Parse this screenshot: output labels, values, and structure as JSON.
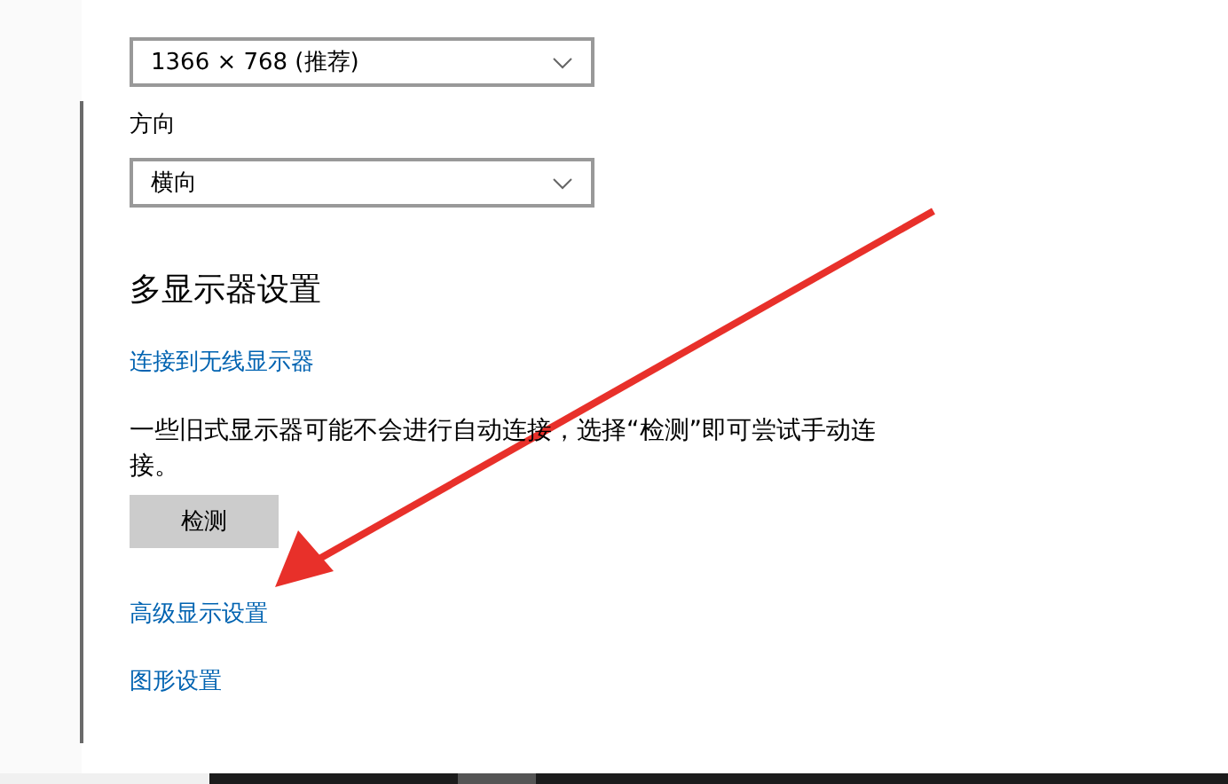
{
  "settings": {
    "dropdowns": [
      {
        "value": "1366 × 768 (推荐)"
      },
      {
        "label": "方向",
        "value": "横向"
      }
    ],
    "section_title": "多显示器设置",
    "wireless_link": "连接到无线显示器",
    "description": "一些旧式显示器可能不会进行自动连接，选择“检测”即可尝试手动连接。",
    "detect_button": "检测",
    "links": [
      "高级显示设置",
      "图形设置"
    ]
  }
}
